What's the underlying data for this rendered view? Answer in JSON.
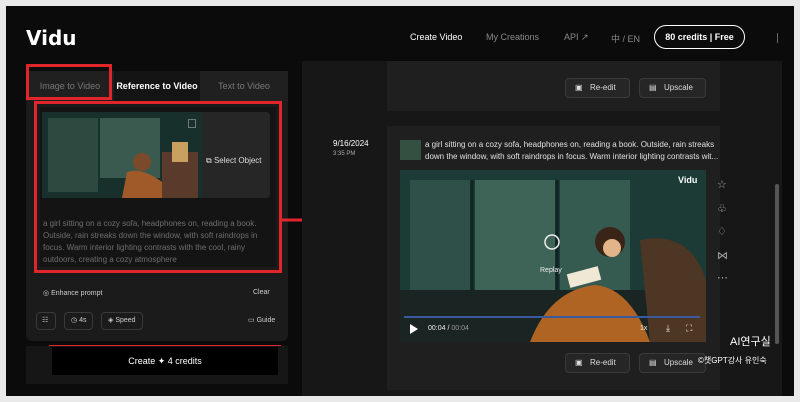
{
  "header": {
    "logo": "Vidu",
    "nav": [
      "Create Video",
      "My Creations",
      "API ↗",
      "中 / EN"
    ],
    "credits": "80 credits | Free"
  },
  "left_panel": {
    "tabs": [
      "Image to Video",
      "Reference to Video",
      "Text to Video"
    ],
    "active_tab": "Reference to Video",
    "select_object": "Select Object",
    "prompt": "a girl sitting on a cozy sofa, headphones on, reading a book. Outside, rain streaks down the window, with soft raindrops in focus. Warm interior lighting contrasts with the cool, rainy outdoors, creating a cozy atmosphere",
    "enhance_prompt": "Enhance prompt",
    "clear": "Clear",
    "duration": "4s",
    "speed": "Speed",
    "guide": "Guide",
    "create_button": "Create ✦ 4 credits"
  },
  "results": {
    "reedit": "Re-edit",
    "upscale": "Upscale",
    "date": "9/16/2024",
    "time": "3:35 PM",
    "prompt": "a girl sitting on a cozy sofa, headphones on, reading a book. Outside, rain streaks down the window, with soft raindrops in focus. Warm interior lighting contrasts with the cool, rainy outdoors, creating a cozy atmosphere",
    "prompt_line1": "a girl sitting on a cozy sofa, headphones on, reading a book. Outside, rain streaks",
    "prompt_line2": "down the window, with soft raindrops in focus. Warm interior lighting contrasts wit...",
    "video": {
      "watermark": "Vidu",
      "replay": "Replay",
      "time_current": "00:04",
      "time_separator": " / ",
      "time_total": "00:04",
      "speed": "1x"
    }
  },
  "overlay": {
    "brand": "AI연구실",
    "credit": "©챗GPT강사 유인숙"
  },
  "colors": {
    "accent_red": "#e0262b",
    "background": "#0b0b0b"
  }
}
